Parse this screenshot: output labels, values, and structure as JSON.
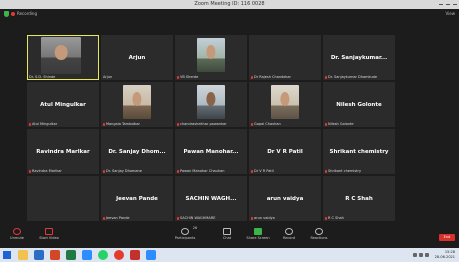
{
  "window": {
    "title": "Zoom Meeting ID: 116 0028"
  },
  "topbar": {
    "recording_label": "Recording",
    "view_label": "View"
  },
  "participants": [
    {
      "big": "",
      "caption": "Dr. S.D. Shinde",
      "video": "v1",
      "muted": false,
      "active": true
    },
    {
      "big": "Arjun",
      "caption": "Arjun",
      "video": "",
      "muted": false,
      "active": false
    },
    {
      "big": "",
      "caption": "VB Sherde",
      "video": "v2",
      "muted": true,
      "active": false
    },
    {
      "big": "",
      "caption": "Dr Rajesh Chandekar",
      "video": "",
      "muted": true,
      "active": false
    },
    {
      "big": "Dr. Sanjaykumar...",
      "caption": "Dr. Sanjaykumar Dhamkude",
      "video": "",
      "muted": true,
      "active": false
    },
    {
      "big": "Atul Mingulkar",
      "caption": "Atul Mingulkar",
      "video": "",
      "muted": true,
      "active": false
    },
    {
      "big": "",
      "caption": "Mangala Tambolkar",
      "video": "v3",
      "muted": true,
      "active": false
    },
    {
      "big": "",
      "caption": "chandrashekhar pawankar",
      "video": "v4",
      "muted": true,
      "active": false
    },
    {
      "big": "",
      "caption": "Gopal Chavhan",
      "video": "v5",
      "muted": true,
      "active": false
    },
    {
      "big": "Nilesh Golonte",
      "caption": "Nilesh Golonte",
      "video": "",
      "muted": true,
      "active": false
    },
    {
      "big": "Ravindra Marlkar",
      "caption": "Ravindra Marlkar",
      "video": "",
      "muted": true,
      "active": false
    },
    {
      "big": "Dr. Sanjay Dhom...",
      "caption": "Dr. Sanjay Dhomane",
      "video": "",
      "muted": true,
      "active": false
    },
    {
      "big": "Pawan Manohar...",
      "caption": "Pawan Manohar Chauhan",
      "video": "",
      "muted": true,
      "active": false
    },
    {
      "big": "Dr V R Patil",
      "caption": "Dr V R Patil",
      "video": "",
      "muted": true,
      "active": false
    },
    {
      "big": "Shrikant chemistry",
      "caption": "Shrikant chemistry",
      "video": "",
      "muted": true,
      "active": false
    },
    {
      "big": "",
      "caption": "",
      "video": "",
      "muted": false,
      "active": false
    },
    {
      "big": "Jeevan Pande",
      "caption": "Jeevan Pande",
      "video": "",
      "muted": true,
      "active": false
    },
    {
      "big": "SACHIN WAGH...",
      "caption": "SACHIN WAGHMARE",
      "video": "",
      "muted": true,
      "active": false
    },
    {
      "big": "arun vaidya",
      "caption": "arun vaidya",
      "video": "",
      "muted": true,
      "active": false
    },
    {
      "big": "R C Shah",
      "caption": "R C Shah",
      "video": "",
      "muted": true,
      "active": false
    }
  ],
  "toolbar": {
    "unmute": "Unmute",
    "start_video": "Start Video",
    "participants": "Participants",
    "participants_count": "26",
    "chat": "Chat",
    "share_screen": "Share Screen",
    "record": "Record",
    "reactions": "Reactions",
    "end": "End"
  },
  "taskbar": {
    "time": "15:28",
    "date": "28-06-2021"
  }
}
